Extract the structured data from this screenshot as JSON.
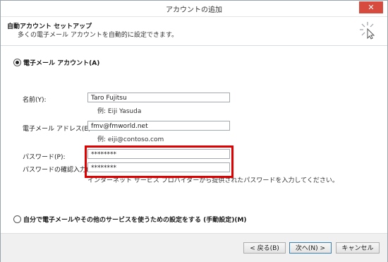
{
  "window": {
    "title": "アカウントの追加",
    "close_label": "✕"
  },
  "header": {
    "title": "自動アカウント セットアップ",
    "subtitle": "多くの電子メール アカウントを自動的に設定できます。"
  },
  "account_type": {
    "email_option": "電子メール アカウント(A)",
    "manual_option": "自分で電子メールやその他のサービスを使うための設定をする (手動設定)(M)",
    "selected": "email"
  },
  "form": {
    "name": {
      "label": "名前(Y):",
      "value": "Taro Fujitsu",
      "example": "例: Eiji Yasuda"
    },
    "email": {
      "label": "電子メール アドレス(E):",
      "value": "fmv@fmworld.net",
      "example": "例: eiji@contoso.com"
    },
    "password": {
      "label": "パスワード(P):",
      "value": "********"
    },
    "password_confirm": {
      "label": "パスワードの確認入力(T):",
      "value": "********"
    },
    "note": "インターネット サービス プロバイダーから提供されたパスワードを入力してください。"
  },
  "buttons": {
    "back": "< 戻る(B)",
    "next": "次へ(N) >",
    "cancel": "キャンセル"
  },
  "colors": {
    "highlight": "#e00000",
    "close": "#d74b3f"
  }
}
